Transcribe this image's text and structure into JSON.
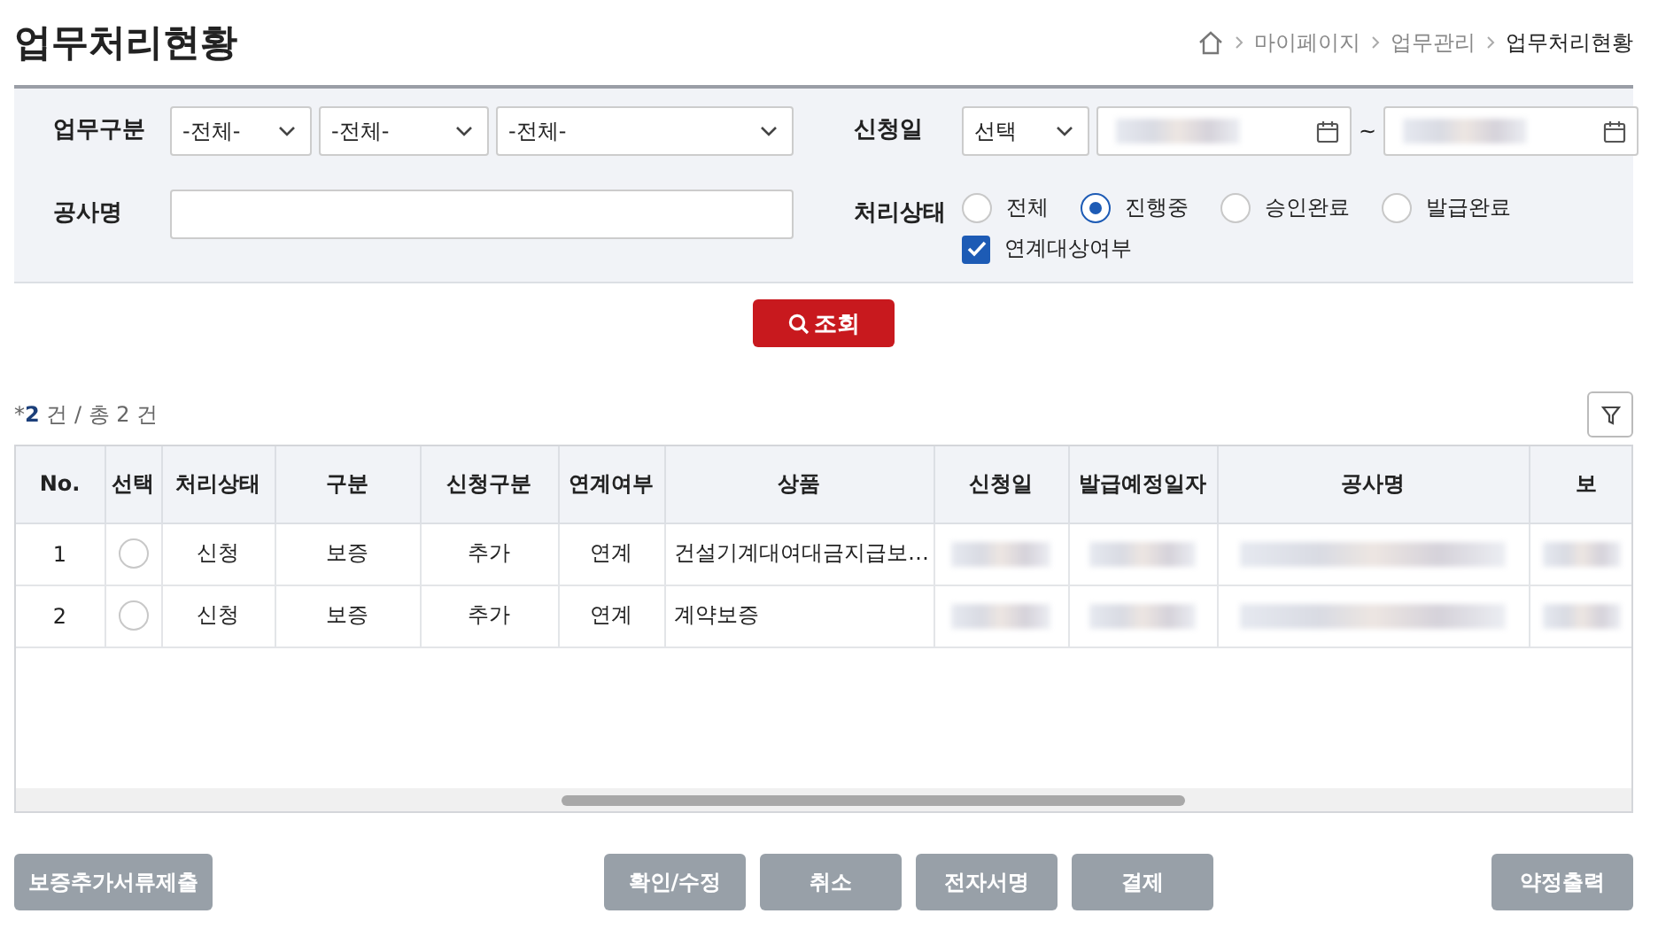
{
  "page": {
    "title": "업무처리현황"
  },
  "breadcrumb": [
    {
      "label": "마이페이지",
      "current": false
    },
    {
      "label": "업무관리",
      "current": false
    },
    {
      "label": "업무처리현황",
      "current": true
    }
  ],
  "filters": {
    "work_type": {
      "label": "업무구분",
      "selects": [
        "-전체-",
        "-전체-",
        "-전체-"
      ]
    },
    "apply_date": {
      "label": "신청일",
      "select": "선택",
      "separator": "~"
    },
    "project_name": {
      "label": "공사명"
    },
    "status": {
      "label": "처리상태",
      "options": [
        {
          "label": "전체",
          "selected": false
        },
        {
          "label": "진행중",
          "selected": true
        },
        {
          "label": "승인완료",
          "selected": false
        },
        {
          "label": "발급완료",
          "selected": false
        }
      ],
      "link_check": {
        "label": "연계대상여부",
        "checked": true
      }
    }
  },
  "search_button": "조회",
  "count": {
    "prefix": "*",
    "number": "2",
    "rest": "건 / 총 2 건"
  },
  "table": {
    "columns": [
      "No.",
      "선택",
      "처리상태",
      "구분",
      "신청구분",
      "연계여부",
      "상품",
      "신청일",
      "발급예정일자",
      "공사명",
      "보"
    ],
    "rows": [
      {
        "no": "1",
        "selected": false,
        "status": "신청",
        "type": "보증",
        "apply_type": "추가",
        "linked": "연계",
        "product": "건설기계대여대금지급보…"
      },
      {
        "no": "2",
        "selected": false,
        "status": "신청",
        "type": "보증",
        "apply_type": "추가",
        "linked": "연계",
        "product": "계약보증"
      }
    ]
  },
  "buttons": {
    "left": [
      "보증추가서류제출"
    ],
    "center": [
      "확인/수정",
      "취소",
      "전자서명",
      "결제"
    ],
    "right": [
      "약정출력"
    ]
  }
}
